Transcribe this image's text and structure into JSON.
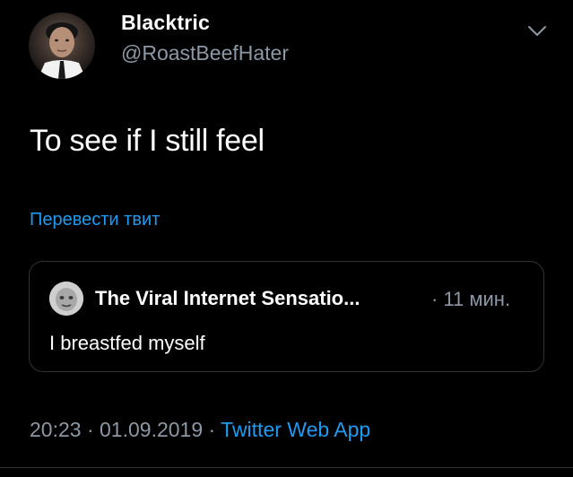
{
  "author": {
    "name": "Blacktric",
    "handle": "@RoastBeefHater"
  },
  "tweet": {
    "text": "To see if I still feel",
    "translate_label": "Перевести твит"
  },
  "quoted": {
    "name": "The Viral Internet Sensatio...",
    "time": "· 11 мин.",
    "text": "I breastfed myself"
  },
  "meta": {
    "time": "20:23",
    "sep1": " · ",
    "date": "01.09.2019",
    "sep2": " · ",
    "source": "Twitter Web App"
  },
  "colors": {
    "background": "#000000",
    "link": "#1d9bf0",
    "secondary_text": "#8b98a5",
    "border": "#2f3336"
  },
  "icons": {
    "caret": "chevron-down-icon"
  }
}
